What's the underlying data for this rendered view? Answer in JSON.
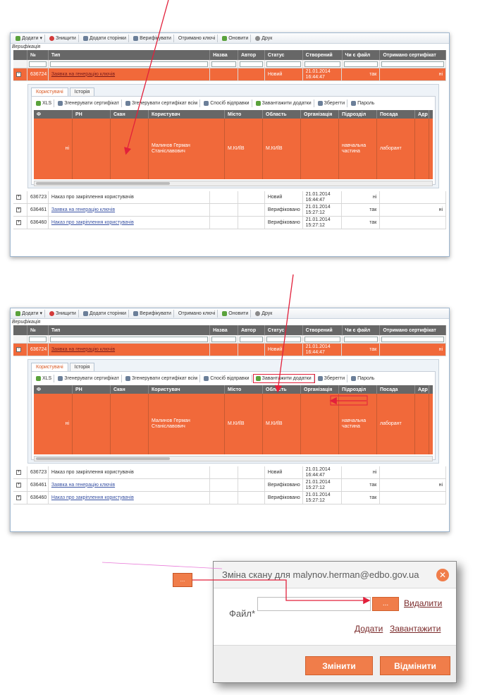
{
  "toolbar": {
    "add": "Додати",
    "delete": "Знищити",
    "add_pages": "Додати сторінки",
    "verify": "Верифікувати",
    "keys": "Отримано ключі",
    "refresh": "Оновити",
    "print": "Друк"
  },
  "subtitle": "Верифікація",
  "columns": [
    "№",
    "Тип",
    "Назва",
    "Автор",
    "Статус",
    "Створений",
    "Чи є файл",
    "Отримано сертифікат"
  ],
  "selected_row": {
    "id": "636724",
    "type": "Заявка на генерацію ключів",
    "status": "Новий",
    "created": "21.01.2014 16:44:47",
    "has_file": "так",
    "cert": "ні"
  },
  "detail": {
    "tab_users": "Користувачі",
    "tab_history": "Історія",
    "tb_xls": "XLS",
    "tb_gen_cert": "Згенерувати сертифікат",
    "tb_gen_cert_all": "Згенерувати сертифікат всім",
    "tb_send": "Спосіб відправки",
    "tb_download": "Завантажити додатки",
    "tb_save": "Зберегти",
    "tb_password": "Пароль",
    "columns": [
      "Ф",
      "РН",
      "Скан",
      "Користувач",
      "Місто",
      "Область",
      "Організація",
      "Підрозділ",
      "Посада",
      "Адр"
    ],
    "row": {
      "f": "ні",
      "rn": "",
      "scan": "",
      "user": "Малинов Герман Станіславович",
      "city": "М.КИЇВ",
      "region": "М.КИЇВ",
      "org": "",
      "dept": "навчальна частина",
      "pos": "лаборант"
    }
  },
  "rows": [
    {
      "id": "636723",
      "type": "Наказ про закріплення користувачів",
      "status": "Новий",
      "created": "21.01.2014 16:44:47",
      "has_file": "ні",
      "cert": "",
      "link": false
    },
    {
      "id": "636461",
      "type": "Заявка на генерацію ключів",
      "status": "Верифіковано",
      "created": "21.01.2014 15:27:12",
      "has_file": "так",
      "cert": "ні",
      "link": true
    },
    {
      "id": "636460",
      "type": "Наказ про закріплення користувачів",
      "status": "Верифіковано",
      "created": "21.01.2014 15:27:12",
      "has_file": "так",
      "cert": "",
      "link": true
    }
  ],
  "dialog": {
    "title": "Зміна скану для malynov.herman@edbo.gov.ua",
    "file_label": "Файл*",
    "browse": "...",
    "remove": "Видалити",
    "add": "Додати",
    "download": "Завантажити",
    "ok": "Змінити",
    "cancel": "Відмінити"
  },
  "float_icon": "...",
  "colors": {
    "accent": "#f1693a",
    "header": "#676767",
    "arrow": "#e2203b",
    "leader": "#e87ad8"
  }
}
